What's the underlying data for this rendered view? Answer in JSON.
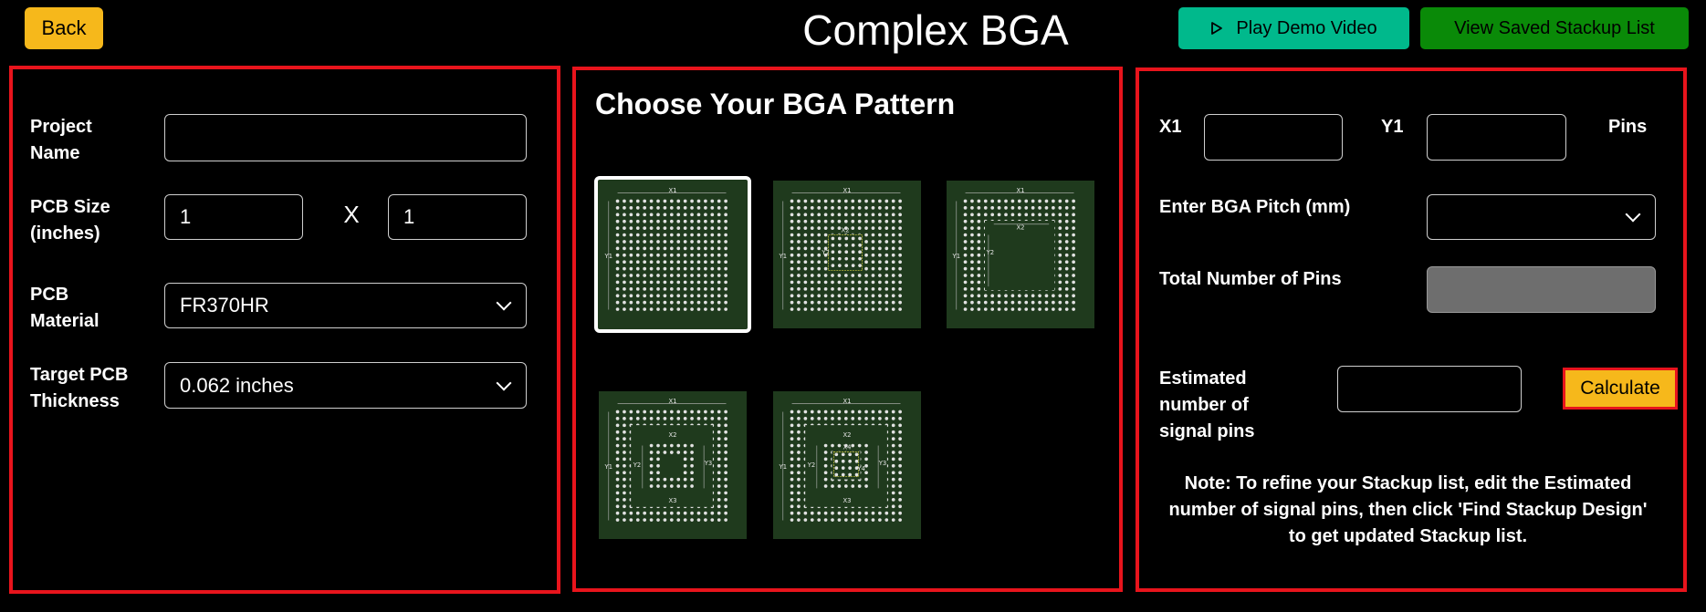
{
  "header": {
    "back_label": "Back",
    "title": "Complex BGA",
    "demo_label": "Play Demo Video",
    "saved_label": "View Saved Stackup List"
  },
  "left": {
    "project_name_label": "Project Name",
    "project_name_value": "",
    "pcb_size_label": "PCB Size (inches)",
    "pcb_size_x": "1",
    "pcb_size_sep": "X",
    "pcb_size_y": "1",
    "material_label": "PCB Material",
    "material_value": "FR370HR",
    "thickness_label": "Target PCB Thickness",
    "thickness_value": "0.062 inches"
  },
  "middle": {
    "title": "Choose Your BGA Pattern",
    "patterns": [
      {
        "labels": [
          "X1",
          "Y1"
        ],
        "selected": true
      },
      {
        "labels": [
          "X1",
          "Y1",
          "X2",
          "Y2"
        ],
        "selected": false
      },
      {
        "labels": [
          "X1",
          "Y1",
          "X2",
          "Y2"
        ],
        "selected": false
      },
      {
        "labels": [
          "X1",
          "Y1",
          "X2",
          "Y2",
          "X3",
          "Y3"
        ],
        "selected": false
      },
      {
        "labels": [
          "X1",
          "Y1",
          "X2",
          "Y2",
          "X3",
          "Y3",
          "X4",
          "Y4"
        ],
        "selected": false
      }
    ]
  },
  "right": {
    "x1_label": "X1",
    "x1_value": "",
    "y1_label": "Y1",
    "y1_value": "",
    "pins_label": "Pins",
    "pitch_label": "Enter BGA Pitch (mm)",
    "pitch_value": "",
    "total_pins_label": "Total Number of Pins",
    "total_pins_value": "",
    "signal_pins_label": "Estimated number of signal pins",
    "signal_pins_value": "",
    "calculate_label": "Calculate",
    "note": "Note: To refine your Stackup list, edit the Estimated number of signal pins, then click 'Find Stackup Design' to get updated Stackup list."
  },
  "colors": {
    "accent_yellow": "#f6b81b",
    "demo_green": "#00b98c",
    "saved_green": "#0a8a08",
    "panel_border": "#e8141c",
    "card_bg": "#1f3a1d"
  }
}
